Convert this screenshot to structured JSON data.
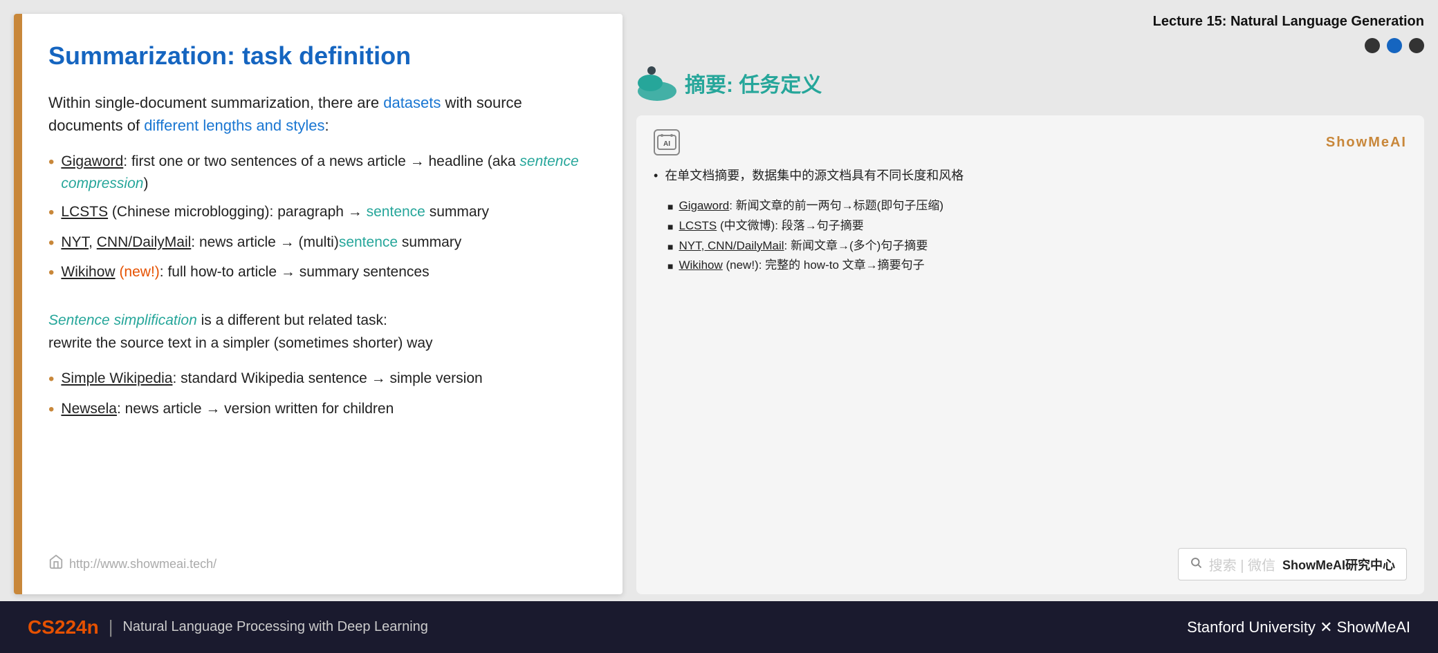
{
  "lecture": {
    "title": "Lecture 15: Natural Language Generation"
  },
  "slide": {
    "title": "Summarization: task definition",
    "intro_part1": "Within single-document summarization, there are ",
    "intro_link1": "datasets",
    "intro_part2": " with source documents of ",
    "intro_link2": "different lengths and styles",
    "intro_part3": ":",
    "bullets": [
      {
        "prefix": "Gigaword",
        "text1": ": first one or two sentences of a news article → headline (aka ",
        "italic_text": "sentence compression",
        "text2": ")"
      },
      {
        "prefix": "LCSTS",
        "text1": " (Chinese microblogging): paragraph → ",
        "teal_text": "sentence",
        "text2": " summary"
      },
      {
        "prefix": "NYT",
        "comma": ", ",
        "prefix2": "CNN/DailyMail",
        "text1": ": news article → (multi)",
        "teal_text": "sentence",
        "text2": " summary"
      },
      {
        "prefix": "Wikihow",
        "orange_text": " (new!)",
        "text1": ": full how-to article → summary sentences"
      }
    ],
    "sentence_simplification_italic": "Sentence simplification",
    "sentence_simplification_text": " is a different but related task:\nrewrite the source text in a simpler (sometimes shorter) way",
    "bullets2": [
      {
        "prefix": "Simple Wikipedia",
        "text1": ": standard Wikipedia sentence → simple version"
      },
      {
        "prefix": "Newsela",
        "text1": ": news article → version written for children"
      }
    ],
    "url": "http://www.showmeai.tech/"
  },
  "showmeai_card": {
    "ai_icon_label": "AI",
    "brand_label": "ShowMeAI",
    "main_bullet": "在单文档摘要，数据集中的源文档具有不同长度和风格",
    "sub_bullets": [
      "Gigaword: 新闻文章的前一两句→标题(即句子压缩)",
      "LCSTS (中文微博): 段落→句子摘要",
      "NYT, CNN/DailyMail: 新闻文章→(多个)句子摘要",
      "Wikihow (new!): 完整的 how-to 文章→摘要句子"
    ],
    "sub_bullets_underline": [
      "Gigaword",
      "LCSTS",
      "NYT, CNN/DailyMail",
      "Wikihow"
    ]
  },
  "right_panel": {
    "heading": "摘要: 任务定义",
    "dots": [
      "inactive",
      "active",
      "inactive"
    ],
    "search_text": "搜索 | 微信 ShowMeAI研究中心"
  },
  "footer": {
    "course_code": "CS224n",
    "divider": "|",
    "subtitle": "Natural Language Processing with Deep Learning",
    "university": "Stanford University",
    "x_symbol": "✕",
    "brand": "ShowMeAI"
  }
}
